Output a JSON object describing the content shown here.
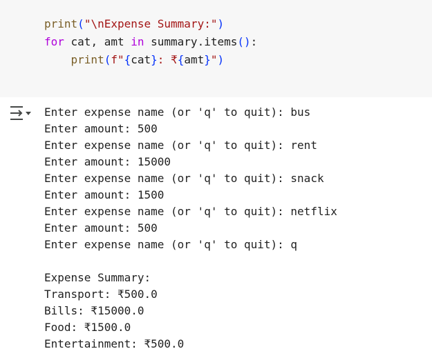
{
  "code_cell": {
    "line1": {
      "fn": "print",
      "open": "(",
      "str": "\"\\nExpense Summary:\"",
      "close": ")"
    },
    "line2": {
      "kw_for": "for",
      "vars": " cat, amt ",
      "kw_in": "in",
      "call": " summary.items",
      "parens": "()",
      "colon": ":"
    },
    "line3": {
      "indent": "    ",
      "fn": "print",
      "open": "(",
      "str_a": "f\"",
      "brace1_open": "{",
      "var1": "cat",
      "brace1_close": "}",
      "str_b": ": ₹",
      "brace2_open": "{",
      "var2": "amt",
      "brace2_close": "}",
      "str_c": "\"",
      "close": ")"
    }
  },
  "output": {
    "icon": "output-toggle-icon",
    "lines": [
      "Enter expense name (or 'q' to quit): bus",
      "Enter amount: 500",
      "Enter expense name (or 'q' to quit): rent",
      "Enter amount: 15000",
      "Enter expense name (or 'q' to quit): snack",
      "Enter amount: 1500",
      "Enter expense name (or 'q' to quit): netflix",
      "Enter amount: 500",
      "Enter expense name (or 'q' to quit): q",
      "",
      "Expense Summary:",
      "Transport: ₹500.0",
      "Bills: ₹15000.0",
      "Food: ₹1500.0",
      "Entertainment: ₹500.0"
    ]
  }
}
